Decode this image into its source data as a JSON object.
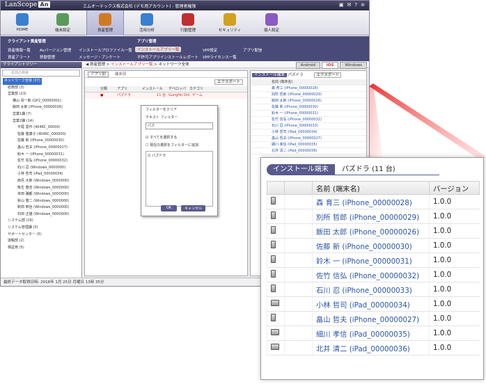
{
  "window": {
    "logo": "LanScope",
    "logo_badge": "An",
    "company": "エムオーテックス株式会社 (デモ用アカウント) - 管理者権限"
  },
  "toolbar": {
    "items": [
      {
        "label": "HOME",
        "color": "#3a7fd0"
      },
      {
        "label": "端末設定",
        "color": "#5a9a5a"
      },
      {
        "label": "資産管理",
        "color": "#d07a20"
      },
      {
        "label": "活用分析",
        "color": "#3a7fd0"
      },
      {
        "label": "行動管理",
        "color": "#c03030"
      },
      {
        "label": "セキュリティ",
        "color": "#d0a020"
      },
      {
        "label": "個人設定",
        "color": "#8a5ac0"
      }
    ]
  },
  "menu": {
    "group1_title": "クライアント資産管理",
    "group2_title": "アプリ管理",
    "row1": [
      "資産情報一覧",
      "Avバージョン管理",
      "インストールプロファイル一覧",
      "インストールアプリ一覧",
      "VPP設定",
      "アプリ配信"
    ],
    "row2": [
      "資産アラート",
      "移動管理",
      "メッセージ・アンケート",
      "不許可アプリインストールレポート",
      "VPPライセンス一覧"
    ]
  },
  "tree": {
    "title": "クライアントツリー",
    "search_placeholder": "名前の検索",
    "nodes": [
      "ネットワーク全体 (37)",
      "総務部 (3)",
      "営業部 (23)",
      "横山 栄一郎 (GP2_00000001)",
      "飯田 太郎 (iPhone_00000026)",
      "営業1課 (7)",
      "営業2課 (14)",
      "平尾 雲作 (404KC_00000)",
      "佐藤 隆康子 (404KC_000000)",
      "佐藤 新 (iPhone_00000030)",
      "畠山 哲夫 (iPhone_00000027)",
      "鈴木 一 (iPhone_00000031)",
      "佐竹 信弘 (iPhone_00000032)",
      "石川 忍 (Windows_0000000)",
      "小林 哲司 (iPad_00000034)",
      "西島 大郎 (Windows_0000000)",
      "柴生 春吉 (Windows_0000000)",
      "米田 彌都 (Windows_0000000)",
      "秋山 隆二 (Windows_0000000)",
      "新田 倒治 (Windows_0000000)",
      "石田 正雄 (Windows_0000000)",
      "システム部 (16)",
      "システム管理課 (3)",
      "サポートセンター (5)",
      "運輸部 (2)",
      "検証用 (5)"
    ]
  },
  "breadcrumb": {
    "root": "資産管理",
    "mid": "インストールアプリ一覧",
    "current": "ネットワーク全体"
  },
  "os_tabs": [
    "Android",
    "iOS",
    "Windows"
  ],
  "sub_tabs": [
    "アプリ別",
    "端末別"
  ],
  "export_label": "エクスポート",
  "app_table": {
    "headers": [
      "分類",
      "アプリ",
      "インストール",
      "デベロッパ",
      "カテゴリ"
    ],
    "row": {
      "app": "パズドラ",
      "installs": "11 台",
      "developer": "GungHo Online E",
      "category": "ゲーム"
    }
  },
  "filter_popup": {
    "clear": "フィルターをクリア",
    "text_filter": "テキスト フィルター",
    "input_value": "パズ",
    "select_all": "すべてを選択する",
    "add_current": "現在の選択をフィルターに追加",
    "item": "パズドラ",
    "ok": "OK",
    "cancel": "キャンセル"
  },
  "status": "最終データ取得日時: 2016年 1月 25日 月曜日 13時 35分",
  "zoom": {
    "tab_label": "インストール端末",
    "title": "パズドラ (11 台)",
    "col_name": "名前 (端末名)",
    "col_version": "バージョン",
    "rows": [
      {
        "name": "森 育三 (iPhone_00000028)",
        "version": "1.0.0",
        "device": "phone"
      },
      {
        "name": "別所 哲郎 (iPhone_00000029)",
        "version": "1.0.0",
        "device": "phone"
      },
      {
        "name": "飯田 太郎 (iPhone_00000026)",
        "version": "1.0.0",
        "device": "phone"
      },
      {
        "name": "佐藤 新 (iPhone_00000030)",
        "version": "1.0.0",
        "device": "phone"
      },
      {
        "name": "鈴木 一 (iPhone_00000031)",
        "version": "1.0.0",
        "device": "phone"
      },
      {
        "name": "佐竹 信弘 (iPhone_00000032)",
        "version": "1.0.0",
        "device": "phone"
      },
      {
        "name": "石川 忍 (iPhone_00000033)",
        "version": "1.0.0",
        "device": "phone"
      },
      {
        "name": "小林 哲司 (iPad_00000034)",
        "version": "1.0.0",
        "device": "pad"
      },
      {
        "name": "畠山 哲夫 (iPhone_00000027)",
        "version": "1.0.0",
        "device": "phone"
      },
      {
        "name": "細川 孝信 (iPad_00000035)",
        "version": "1.0.0",
        "device": "pad"
      },
      {
        "name": "北井 清二 (iPad_00000036)",
        "version": "1.0.0",
        "device": "pad"
      }
    ]
  }
}
